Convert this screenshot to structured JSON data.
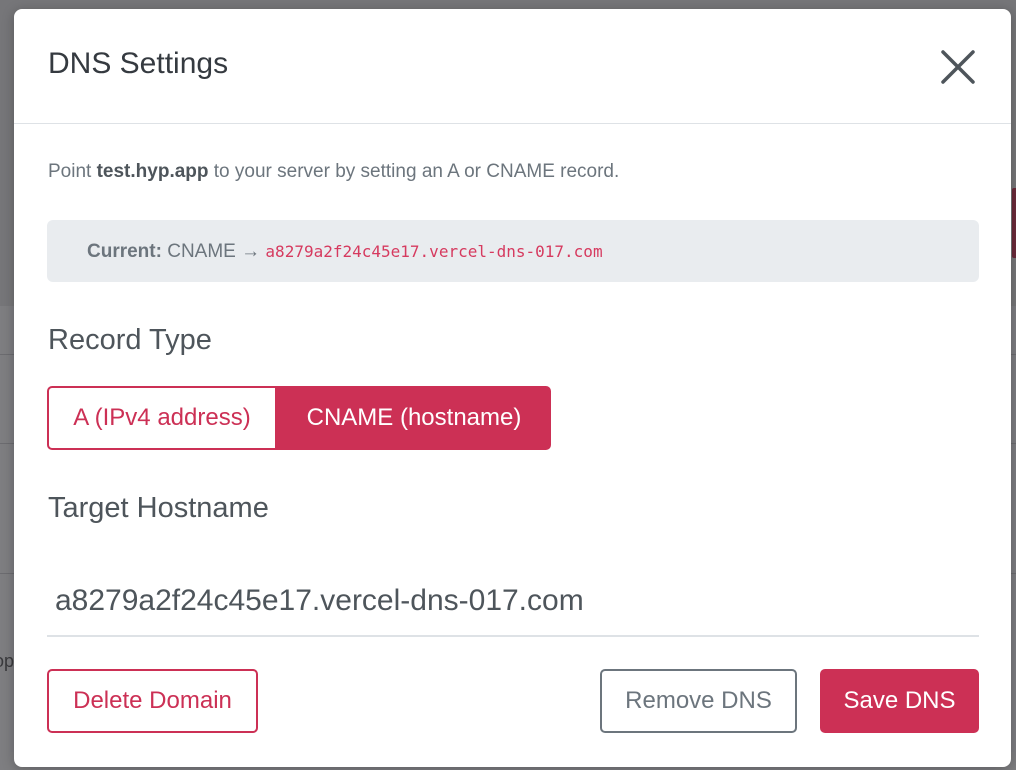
{
  "background": {
    "partial_text": "op"
  },
  "modal": {
    "title": "DNS Settings",
    "close_icon": "close-icon",
    "description": {
      "prefix": "Point ",
      "domain": "test.hyp.app",
      "suffix": " to your server by setting an A or CNAME record."
    },
    "current": {
      "label": "Current:",
      "record_type": "CNAME",
      "arrow": "→",
      "value": "a8279a2f24c45e17.vercel-dns-017.com"
    },
    "record_type": {
      "label": "Record Type",
      "options": [
        "A (IPv4 address)",
        "CNAME (hostname)"
      ],
      "selected": "CNAME (hostname)"
    },
    "target": {
      "label": "Target Hostname",
      "value": "a8279a2f24c45e17.vercel-dns-017.com"
    },
    "buttons": {
      "delete": "Delete Domain",
      "remove": "Remove DNS",
      "save": "Save DNS"
    }
  },
  "colors": {
    "accent": "#cc3055",
    "code": "#d63a5f",
    "muted": "#6c757d",
    "current_bg": "#e9ecef"
  }
}
